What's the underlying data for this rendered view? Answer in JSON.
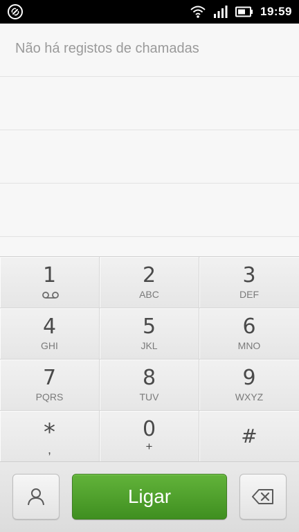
{
  "status_bar": {
    "time": "19:59",
    "icons": [
      "link-notification-icon",
      "wifi-icon",
      "signal-icon",
      "battery-icon"
    ]
  },
  "call_log": {
    "empty_message": "Não há registos de chamadas"
  },
  "keypad": {
    "keys": [
      {
        "digit": "1",
        "letters": "",
        "sub_icon": "voicemail-icon"
      },
      {
        "digit": "2",
        "letters": "ABC"
      },
      {
        "digit": "3",
        "letters": "DEF"
      },
      {
        "digit": "4",
        "letters": "GHI"
      },
      {
        "digit": "5",
        "letters": "JKL"
      },
      {
        "digit": "6",
        "letters": "MNO"
      },
      {
        "digit": "7",
        "letters": "PQRS"
      },
      {
        "digit": "8",
        "letters": "TUV"
      },
      {
        "digit": "9",
        "letters": "WXYZ"
      },
      {
        "digit": "*",
        "letters": ","
      },
      {
        "digit": "0",
        "letters": "+"
      },
      {
        "digit": "#",
        "letters": ""
      }
    ]
  },
  "actions": {
    "call_label": "Ligar",
    "contacts_icon": "contacts-icon",
    "backspace_icon": "backspace-icon"
  },
  "colors": {
    "call_button": "#4fa22c",
    "status_bar": "#000000"
  }
}
